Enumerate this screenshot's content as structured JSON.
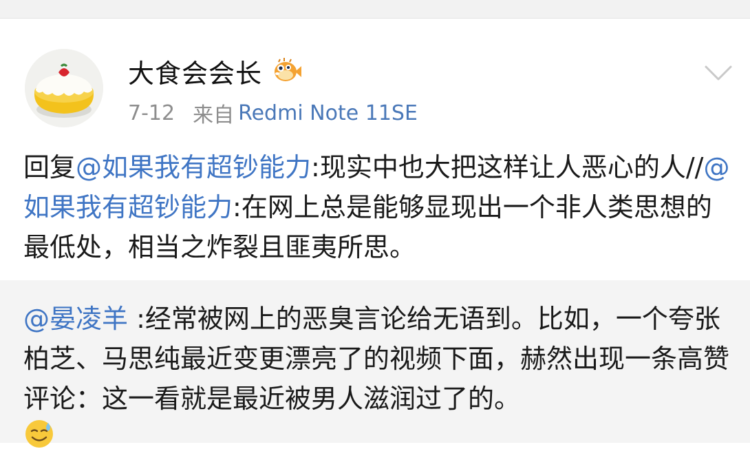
{
  "post": {
    "author": {
      "name": "大食会会长",
      "badge_icon": "pufferfish-badge-icon",
      "avatar_icon": "cake-avatar-icon"
    },
    "meta": {
      "date": "7-12",
      "from_label": "来自",
      "device": "Redmi Note 11SE"
    },
    "menu_icon": "chevron-down-icon",
    "body": {
      "reply_prefix": "回复",
      "mention_1": "@如果我有超钞能力",
      "text_1": ":现实中也大把这样让人恶心的人//",
      "mention_2": "@如果我有超钞能力",
      "text_2": ":在网上总是能够显现出一个非人类思想的最低处，相当之炸裂且匪夷所思。"
    }
  },
  "quoted": {
    "mention": "@晏凌羊",
    "text": " :经常被网上的恶臭言论给无语到。比如，一个夸张柏芝、马思纯最近变更漂亮了的视频下面，赫然出现一条高赞评论：这一看就是最近被男人滋润过了的。",
    "emoji_icon": "sweat-smile-emoji-icon"
  },
  "colors": {
    "link": "#3f75c4",
    "device": "#4a78b8",
    "meta_gray": "#8d8d8d",
    "quoted_bg": "#f4f4f4"
  }
}
